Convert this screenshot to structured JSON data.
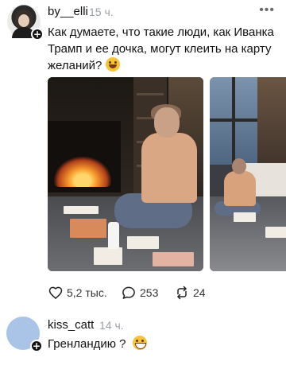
{
  "post": {
    "username": "by__elli",
    "time": "15 ч.",
    "more_label": "•••",
    "text": "Как думаете, что такие люди, как Иванка Трамп и ее дочка, могут клеить на карту желаний?",
    "emoji": "sweat-smile-emoji",
    "follow_badge": "+",
    "gallery": [
      "photo-1",
      "photo-2"
    ],
    "stats": {
      "likes": "5,2 тыс.",
      "comments": "253",
      "reposts": "24"
    }
  },
  "comment": {
    "username": "kiss_catt",
    "time": "14 ч.",
    "text": "Гренландию ?",
    "emoji": "grin-emoji",
    "follow_badge": "+"
  },
  "icons": {
    "like": "heart-icon",
    "comment": "comment-bubble-icon",
    "repost": "repost-icon",
    "more": "more-dots-icon"
  },
  "colors": {
    "text": "#111111",
    "muted": "#9aa0a6",
    "comment_avatar": "#a9c4e6"
  }
}
